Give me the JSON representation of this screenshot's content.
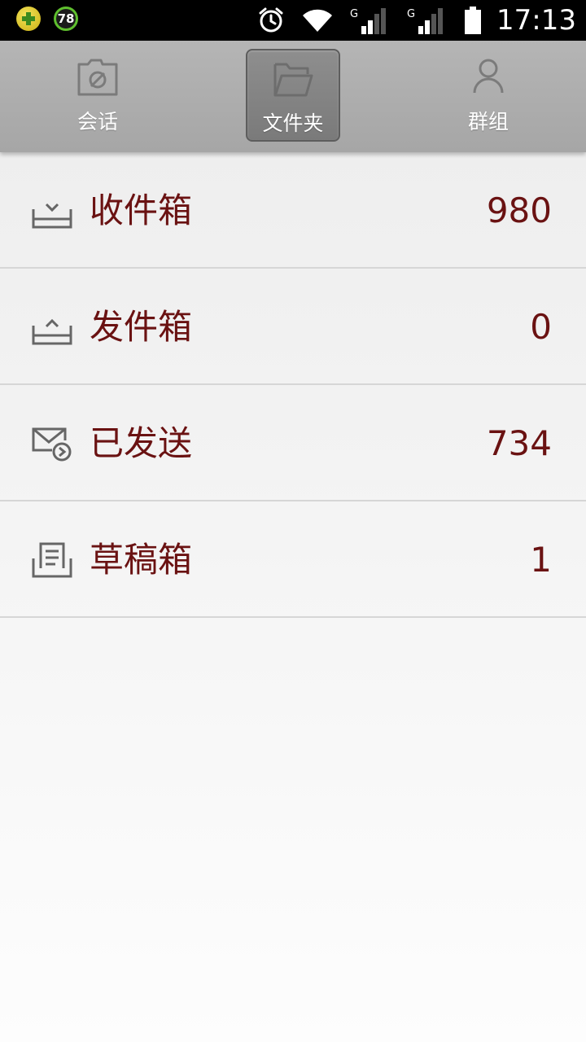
{
  "status_bar": {
    "badge_number": "78",
    "time": "17:13",
    "signal_label_1": "G",
    "signal_label_2": "G",
    "icons": [
      "app-plus-icon",
      "alarm-icon",
      "wifi-icon",
      "signal-icon",
      "signal-icon",
      "battery-icon"
    ]
  },
  "tabs": [
    {
      "label": "会话",
      "icon": "conversation-icon",
      "active": false
    },
    {
      "label": "文件夹",
      "icon": "folder-icon",
      "active": true
    },
    {
      "label": "群组",
      "icon": "person-icon",
      "active": false
    }
  ],
  "folders": [
    {
      "label": "收件箱",
      "count": "980",
      "icon": "inbox-icon"
    },
    {
      "label": "发件箱",
      "count": "0",
      "icon": "outbox-icon"
    },
    {
      "label": "已发送",
      "count": "734",
      "icon": "sent-icon"
    },
    {
      "label": "草稿箱",
      "count": "1",
      "icon": "drafts-icon"
    }
  ],
  "colors": {
    "accent_text": "#6a1212",
    "tab_bar": "#ababab",
    "active_tab": "#848484"
  }
}
